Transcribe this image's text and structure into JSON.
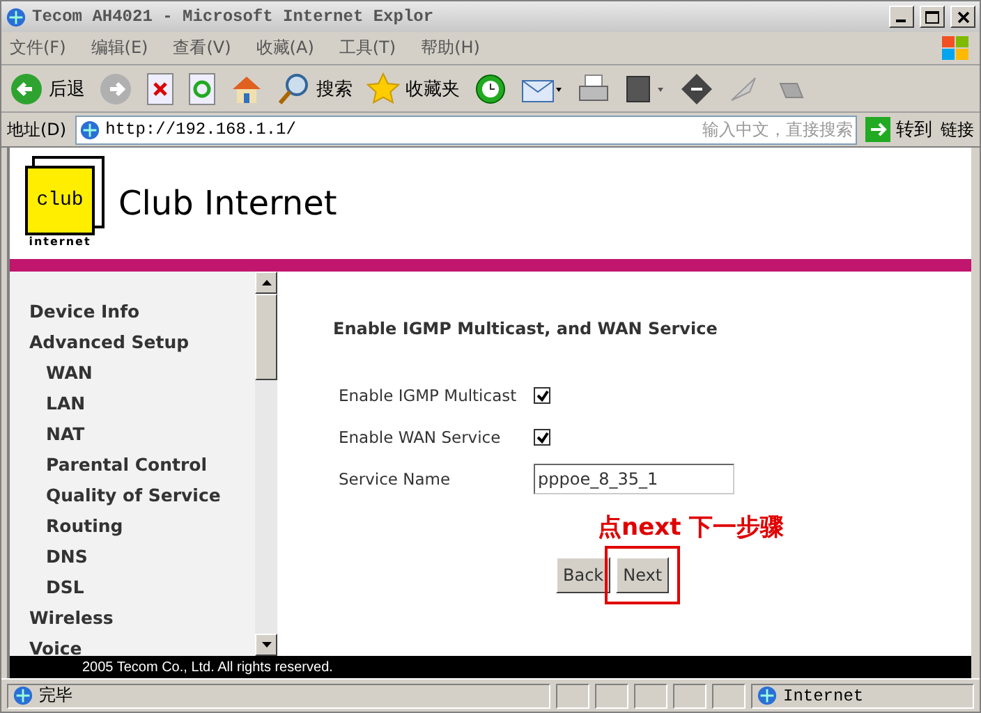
{
  "window": {
    "title": "Tecom AH4021 - Microsoft Internet Explor"
  },
  "menu": [
    "文件(F)",
    "编辑(E)",
    "查看(V)",
    "收藏(A)",
    "工具(T)",
    "帮助(H)"
  ],
  "toolbar": [
    {
      "kind": "back",
      "label": "后退"
    },
    {
      "kind": "forward"
    },
    {
      "kind": "stop"
    },
    {
      "kind": "refresh"
    },
    {
      "kind": "home"
    },
    {
      "kind": "search",
      "label": "搜索"
    },
    {
      "kind": "favorites",
      "label": "收藏夹"
    },
    {
      "kind": "history"
    },
    {
      "kind": "mail"
    },
    {
      "kind": "print"
    },
    {
      "kind": "edit"
    },
    {
      "kind": "discuss"
    },
    {
      "kind": "tool"
    },
    {
      "kind": "plugin"
    }
  ],
  "address_bar": {
    "label": "地址(D)",
    "url": "http://192.168.1.1/",
    "search_placeholder": "输入中文，直接搜索",
    "go": "转到",
    "links": "链接"
  },
  "page": {
    "logo": {
      "mark": "club",
      "caption": "internet",
      "name": "Club Internet"
    },
    "sidebar": [
      {
        "label": "Device Info"
      },
      {
        "label": "Advanced Setup",
        "children": [
          {
            "label": "WAN"
          },
          {
            "label": "LAN"
          },
          {
            "label": "NAT"
          },
          {
            "label": "Parental Control"
          },
          {
            "label": "Quality of Service"
          },
          {
            "label": "Routing"
          },
          {
            "label": "DNS"
          },
          {
            "label": "DSL"
          }
        ]
      },
      {
        "label": "Wireless"
      },
      {
        "label": "Voice"
      }
    ],
    "heading": "Enable IGMP Multicast, and WAN Service",
    "fields": [
      {
        "kind": "checkbox",
        "label": "Enable IGMP Multicast",
        "checked": true
      },
      {
        "kind": "checkbox",
        "label": "Enable WAN Service",
        "checked": true
      },
      {
        "kind": "text",
        "label": "Service Name",
        "value": "pppoe_8_35_1"
      }
    ],
    "annotation": "点next 下一步骤",
    "buttons": [
      {
        "label": "Back",
        "highlighted": false
      },
      {
        "label": "Next",
        "highlighted": true
      }
    ],
    "footer": "2005 Tecom Co., Ltd. All rights reserved."
  },
  "status_bar": {
    "text": "完毕",
    "zone": "Internet"
  }
}
